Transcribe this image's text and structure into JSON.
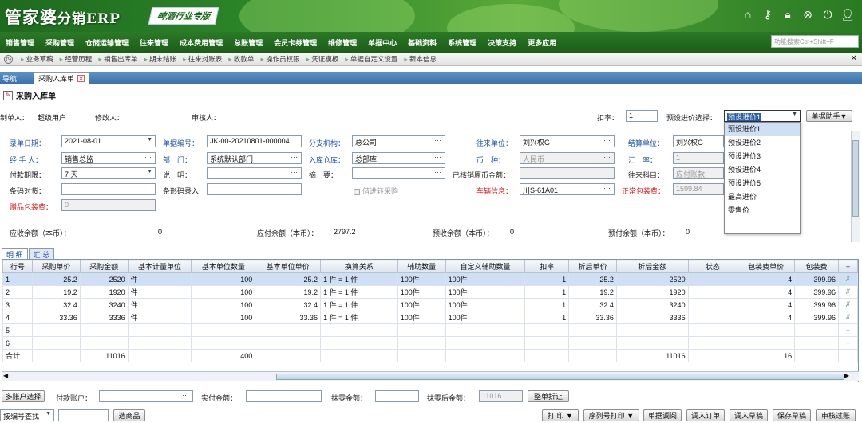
{
  "app": {
    "logo_text": "管家婆",
    "logo_sub": "分销ERP",
    "edition": "啤酒行业专版"
  },
  "top_icons": [
    "home-icon",
    "key-icon",
    "lock-icon",
    "close-circle-icon",
    "power-icon",
    "user-icon"
  ],
  "menu": [
    "销售管理",
    "采购管理",
    "仓储运输管理",
    "往来管理",
    "成本费用管理",
    "总账管理",
    "会员卡券管理",
    "维修管理",
    "单据中心",
    "基础资料",
    "系统管理",
    "决策支持",
    "更多应用"
  ],
  "search": {
    "placeholder": "功能搜索Ctrl+Shift+F"
  },
  "quick_links": [
    "业务草稿",
    "经营历程",
    "销售出库单",
    "期末结账",
    "往来对账表",
    "收款单",
    "操作员权限",
    "凭证模板",
    "单据自定义设置",
    "新本信息"
  ],
  "tabs": {
    "nav": "导航",
    "current": "采购入库单"
  },
  "form": {
    "title": "采购入库单",
    "maker_label": "制单人：",
    "maker": "超级用户",
    "modifier_label": "修改人：",
    "auditor_label": "审核人：",
    "discount_label": "扣率：",
    "discount": "1",
    "preset_label": "预设进价选择：",
    "preset_value": "预设进价1",
    "helper_btn": "单据助手▼",
    "date_label": "录单日期：",
    "date": "2021-08-01",
    "billno_label": "单据编号：",
    "billno": "JK-00-20210801-000004",
    "branch_label": "分支机构：",
    "branch": "总公司",
    "partner_label": "往来单位：",
    "partner": "刘兴权G",
    "settle_label": "结算单位：",
    "settle": "刘兴权G",
    "handler_label": "经 手 人：",
    "handler": "销售总监",
    "dept_label": "部　门：",
    "dept": "系统默认部门",
    "warehouse_label": "入库仓库：",
    "warehouse": "总部库",
    "currency_label": "币　种：",
    "currency": "人民币",
    "rate_label": "汇　率：",
    "rate": "1",
    "payterm_label": "付款期限：",
    "payterm": "7 天",
    "desc_label": "说　明：",
    "summary_label": "摘　要：",
    "verified_label": "已核销原币金额：",
    "account_label": "往来科目：",
    "account": "应付账款",
    "barcode_label": "条码对货：",
    "barcode_entry_label": "条形码录入",
    "borrow_label": "借进转采购",
    "vehicle_label": "车辆信息：",
    "vehicle": "川S-61A01",
    "packfee_label": "正常包装费：",
    "packfee": "1599.84",
    "giftpack_label": "赠品包装费：",
    "giftpack": "0",
    "recv_label": "应收余额（本币）：",
    "recv": "0",
    "pay_label": "应付余额（本币）：",
    "pay": "2797.2",
    "prerecv_label": "预收余额（本币）：",
    "prerecv": "0",
    "prepay_label": "预付余额（本币）：",
    "prepay": "0"
  },
  "preset_options": [
    "预设进价1",
    "预设进价2",
    "预设进价3",
    "预设进价4",
    "预设进价5",
    "最高进价",
    "零售价"
  ],
  "grid": {
    "tabs": [
      "明 细",
      "汇 总"
    ],
    "columns": [
      "行号",
      "采购单价",
      "采购金额",
      "基本计量单位",
      "基本单位数量",
      "基本单位单价",
      "换算关系",
      "辅助数量",
      "自定义辅助数量",
      "扣率",
      "折后单价",
      "折后金额",
      "状态",
      "包装费单价",
      "包装费",
      "+"
    ],
    "rows": [
      [
        "1",
        "25.2",
        "2520",
        "件",
        "100",
        "25.2",
        "1 件 = 1 件",
        "100件",
        "100件",
        "1",
        "25.2",
        "2520",
        "",
        "4",
        "399.96"
      ],
      [
        "2",
        "19.2",
        "1920",
        "件",
        "100",
        "19.2",
        "1 件 = 1 件",
        "100件",
        "100件",
        "1",
        "19.2",
        "1920",
        "",
        "4",
        "399.96"
      ],
      [
        "3",
        "32.4",
        "3240",
        "件",
        "100",
        "32.4",
        "1 件 = 1 件",
        "100件",
        "100件",
        "1",
        "32.4",
        "3240",
        "",
        "4",
        "399.96"
      ],
      [
        "4",
        "33.36",
        "3336",
        "件",
        "100",
        "33.36",
        "1 件 = 1 件",
        "100件",
        "100件",
        "1",
        "33.36",
        "3336",
        "",
        "4",
        "399.96"
      ],
      [
        "5",
        "",
        "",
        "",
        "",
        "",
        "",
        "",
        "",
        "",
        "",
        "",
        "",
        "",
        ""
      ],
      [
        "6",
        "",
        "",
        "",
        "",
        "",
        "",
        "",
        "",
        "",
        "",
        "",
        "",
        "",
        ""
      ]
    ],
    "total": [
      "合计",
      "",
      "11016",
      "",
      "400",
      "",
      "",
      "",
      "",
      "",
      "",
      "11016",
      "",
      "16",
      ""
    ]
  },
  "footer": {
    "multi_account": "多账户选择",
    "pay_account_label": "付款账户：",
    "actual_label": "实付金额：",
    "rounding_label": "抹零金额：",
    "after_label": "抹零后金额：",
    "after": "11016",
    "discount_btn": "整单折让",
    "lookup": "按编号查找",
    "select_goods": "选商品",
    "buttons": [
      "打 印 ▼",
      "序列号打印 ▼",
      "单据调阅",
      "调入订单",
      "调入草稿",
      "保存草稿",
      "审核过账"
    ]
  }
}
